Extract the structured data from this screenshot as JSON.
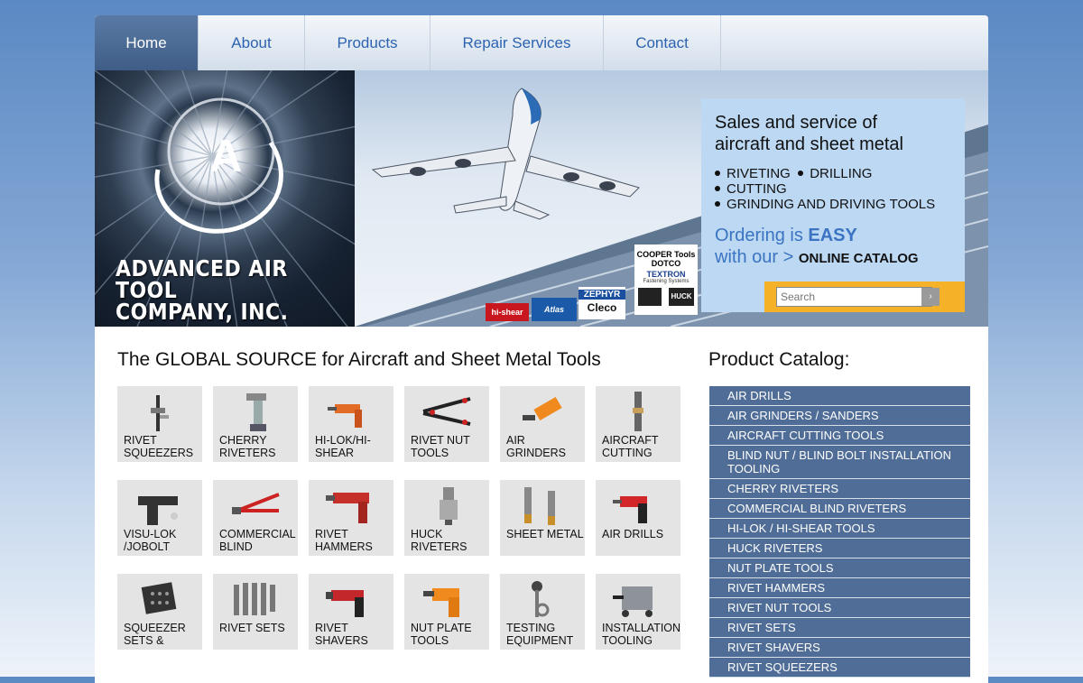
{
  "nav": [
    {
      "label": "Home",
      "active": true
    },
    {
      "label": "About"
    },
    {
      "label": "Products"
    },
    {
      "label": "Repair Services"
    },
    {
      "label": "Contact"
    }
  ],
  "banner": {
    "logo_letter": "A",
    "company_line1": "ADVANCED AIR TOOL",
    "company_line2": "COMPANY, INC.",
    "brand_logos": {
      "cooper": "COOPER Tools",
      "dotco": "DOTCO",
      "textron": "TEXTRON",
      "textron_sub": "Fastening Systems",
      "hishear": "hi-shear",
      "atlas": "Atlas Copco",
      "zephyr": "ZEPHYR",
      "cleco": "Cleco",
      "huck": "HUCK"
    },
    "info": {
      "headline_line1": "Sales and service of",
      "headline_line2": "aircraft and sheet metal",
      "bullet_riveting": "RIVETING",
      "bullet_drilling": "DRILLING",
      "bullet_cutting": "CUTTING",
      "bullet_grinding": "GRINDING AND DRIVING TOOLS",
      "ordering_prefix": "Ordering is ",
      "ordering_emphasis": "EASY",
      "with_our": "with our > ",
      "catalog_link": "ONLINE CATALOG"
    },
    "search": {
      "placeholder": "Search",
      "button": "›"
    }
  },
  "main": {
    "title": "The GLOBAL SOURCE for Aircraft and Sheet Metal Tools",
    "tiles": [
      {
        "label": "RIVET SQUEEZERS",
        "icon": "squeezer-icon"
      },
      {
        "label": "CHERRY RIVETERS",
        "icon": "riveter-icon"
      },
      {
        "label": "HI-LOK/HI-SHEAR",
        "icon": "drill-gun-icon"
      },
      {
        "label": "RIVET NUT TOOLS",
        "icon": "plier-icon"
      },
      {
        "label": "AIR GRINDERS",
        "icon": "grinder-icon"
      },
      {
        "label": "AIRCRAFT CUTTING",
        "icon": "cutter-icon"
      },
      {
        "label": "VISU-LOK /JOBOLT",
        "icon": "gun-icon"
      },
      {
        "label": "COMMERCIAL BLIND",
        "icon": "hand-riveter-icon"
      },
      {
        "label": "RIVET HAMMERS",
        "icon": "hammer-icon"
      },
      {
        "label": "HUCK RIVETERS",
        "icon": "huck-icon"
      },
      {
        "label": "SHEET METAL",
        "icon": "snips-icon"
      },
      {
        "label": "AIR DRILLS",
        "icon": "air-drill-icon"
      },
      {
        "label": "SQUEEZER SETS &",
        "icon": "case-icon"
      },
      {
        "label": "RIVET SETS",
        "icon": "rivet-sets-icon"
      },
      {
        "label": "RIVET SHAVERS",
        "icon": "shaver-icon"
      },
      {
        "label": "NUT PLATE TOOLS",
        "icon": "nutplate-icon"
      },
      {
        "label": "TESTING EQUIPMENT",
        "icon": "tester-icon"
      },
      {
        "label": "INSTALLATION TOOLING",
        "icon": "installer-icon"
      }
    ]
  },
  "sidebar": {
    "title": "Product Catalog:",
    "items": [
      "AIR DRILLS",
      "AIR GRINDERS / SANDERS",
      "AIRCRAFT CUTTING TOOLS",
      "BLIND NUT / BLIND BOLT INSTALLATION TOOLING",
      "CHERRY RIVETERS",
      "COMMERCIAL BLIND RIVETERS",
      "HI-LOK / HI-SHEAR TOOLS",
      "HUCK RIVETERS",
      "NUT PLATE TOOLS",
      "RIVET HAMMERS",
      "RIVET NUT TOOLS",
      "RIVET SETS",
      "RIVET SHAVERS",
      "RIVET SQUEEZERS"
    ]
  },
  "colors": {
    "nav_active": "#4a6a96",
    "info_box": "#bcd8f2",
    "accent_blue": "#3a74c2",
    "search_bg": "#f5b229",
    "catalog_item": "#4f6d96"
  }
}
